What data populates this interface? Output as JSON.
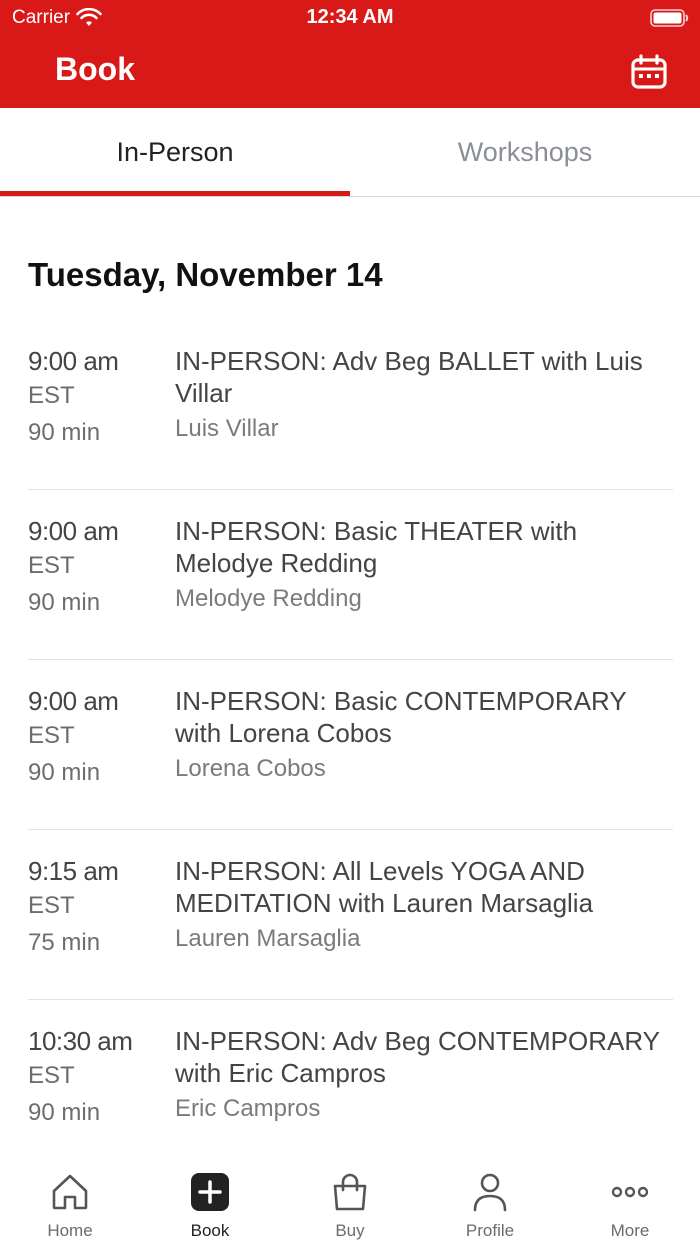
{
  "status_bar": {
    "carrier": "Carrier",
    "time": "12:34 AM"
  },
  "nav": {
    "title": "Book",
    "calendar_icon": "calendar-icon"
  },
  "tabs": [
    {
      "label": "In-Person",
      "active": true
    },
    {
      "label": "Workshops",
      "active": false
    }
  ],
  "date_heading": "Tuesday, November 14",
  "classes": [
    {
      "time": "9:00 am",
      "tz": "EST",
      "duration": "90 min",
      "name": "IN-PERSON: Adv Beg BALLET with Luis Villar",
      "instructor": "Luis Villar"
    },
    {
      "time": "9:00 am",
      "tz": "EST",
      "duration": "90 min",
      "name": "IN-PERSON: Basic THEATER  with Melodye Redding",
      "instructor": "Melodye Redding"
    },
    {
      "time": "9:00 am",
      "tz": "EST",
      "duration": "90 min",
      "name": "IN-PERSON: Basic CONTEMPORARY with Lorena Cobos",
      "instructor": "Lorena Cobos"
    },
    {
      "time": "9:15 am",
      "tz": "EST",
      "duration": "75 min",
      "name": "IN-PERSON: All Levels YOGA AND MEDITATION with Lauren Marsaglia",
      "instructor": "Lauren Marsaglia"
    },
    {
      "time": "10:30 am",
      "tz": "EST",
      "duration": "90 min",
      "name": "IN-PERSON: Adv Beg CONTEMPORARY with Eric Campros",
      "instructor": "Eric Campros"
    }
  ],
  "bottom_nav": [
    {
      "label": "Home",
      "icon": "home-icon",
      "active": false
    },
    {
      "label": "Book",
      "icon": "plus-icon",
      "active": true
    },
    {
      "label": "Buy",
      "icon": "shopping-bag-icon",
      "active": false
    },
    {
      "label": "Profile",
      "icon": "person-icon",
      "active": false
    },
    {
      "label": "More",
      "icon": "more-icon",
      "active": false
    }
  ],
  "colors": {
    "brand": "#d91818",
    "active_tab_text": "#222222",
    "inactive_tab_text": "#8a8f96"
  }
}
